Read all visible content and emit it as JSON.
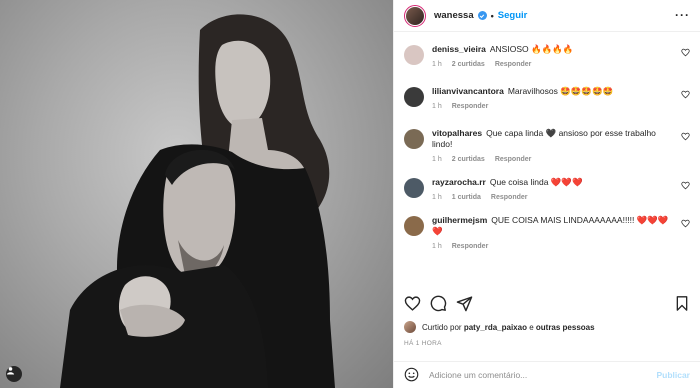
{
  "post": {
    "author": "wanessa",
    "dot": "•",
    "follow_label": "Seguir",
    "more_label": "···"
  },
  "comments": [
    {
      "user": "deniss_vieira",
      "text": "ANSIOSO 🔥🔥🔥🔥",
      "time": "1 h",
      "likes": "2 curtidas",
      "reply": "Responder",
      "avatar_color": "#d9c6c2"
    },
    {
      "user": "lilianvivancantora",
      "text": "Maravilhosos 🤩🤩🤩🤩🤩",
      "time": "1 h",
      "likes": "",
      "reply": "Responder",
      "avatar_color": "#3a3a3a"
    },
    {
      "user": "vitopalhares",
      "text": "Que capa linda 🖤 ansioso por esse trabalho lindo!",
      "time": "1 h",
      "likes": "2 curtidas",
      "reply": "Responder",
      "avatar_color": "#7a6a55"
    },
    {
      "user": "rayzarocha.rr",
      "text": "Que coisa linda ❤️❤️❤️",
      "time": "1 h",
      "likes": "1 curtida",
      "reply": "Responder",
      "avatar_color": "#4d5a66"
    },
    {
      "user": "guilhermejsm",
      "text": "QUE COISA MAIS LINDAAAAAAA!!!!! ❤️❤️❤️ ❤️",
      "time": "1 h",
      "likes": "",
      "reply": "Responder",
      "avatar_color": "#8a6a4a"
    }
  ],
  "likes_line": {
    "prefix": "Curtido por",
    "user": "paty_rda_paixao",
    "middle": "e",
    "others": "outras pessoas"
  },
  "time_ago": "HÁ 1 HORA",
  "comment_box": {
    "placeholder": "Adicione um comentário...",
    "publish_label": "Publicar"
  },
  "icons": [
    "heart-icon",
    "comment-icon",
    "share-icon",
    "bookmark-icon",
    "emoji-icon",
    "more-icon",
    "verified-icon",
    "user-tag-icon"
  ],
  "colors": {
    "accent": "#0095f6",
    "verified": "#3897f0",
    "muted": "#8e8e8e",
    "publish_disabled": "#b2dffc"
  }
}
